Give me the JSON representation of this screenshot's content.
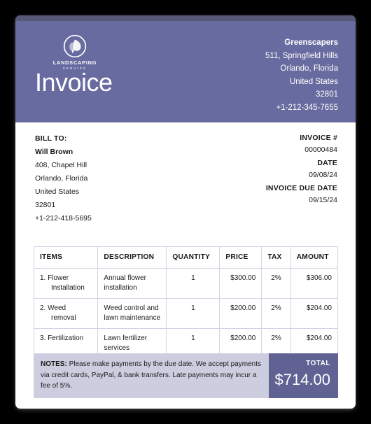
{
  "theme": {
    "header_bg": "#686b9f",
    "header_strip": "#565878",
    "notes_bg": "#cdcde0",
    "total_bg": "#5f6293",
    "page_bg": "#000000",
    "card_bg": "#ffffff",
    "table_border": "#d3d4e2"
  },
  "header": {
    "logo": {
      "icon": "leaf-circle-logo-icon",
      "name": "LANDSCAPING",
      "sub": "SERVICE"
    },
    "title": "Invoice",
    "company": {
      "name": "Greenscapers",
      "address1": "511, Springfield Hills",
      "address2": "Orlando, Florida",
      "country": "United States",
      "zip": "32801",
      "phone": "+1-212-345-7655"
    }
  },
  "bill_to": {
    "label": "BILL TO:",
    "name": "Will Brown",
    "address1": "408, Chapel Hill",
    "address2": "Orlando, Florida",
    "country": "United States",
    "zip": "32801",
    "phone": "+1-212-418-5695"
  },
  "meta": {
    "invoice_number_label": "INVOICE #",
    "invoice_number": "00000484",
    "date_label": "DATE",
    "date": "09/08/24",
    "due_date_label": "INVOICE DUE DATE",
    "due_date": "09/15/24"
  },
  "table": {
    "columns": [
      "ITEMS",
      "DESCRIPTION",
      "QUANTITY",
      "PRICE",
      "TAX",
      "AMOUNT"
    ],
    "rows": [
      {
        "item": "1. Flower Installation",
        "description": "Annual flower installation",
        "quantity": "1",
        "price": "$300.00",
        "tax": "2%",
        "amount": "$306.00"
      },
      {
        "item": "2. Weed removal",
        "description": "Weed control and lawn maintenance",
        "quantity": "1",
        "price": "$200.00",
        "tax": "2%",
        "amount": "$204.00"
      },
      {
        "item": "3. Fertilization",
        "description": "Lawn fertilizer services",
        "quantity": "1",
        "price": "$200.00",
        "tax": "2%",
        "amount": "$204.00"
      }
    ]
  },
  "footer": {
    "notes_label": "NOTES:",
    "notes_text": "Please make payments by the due date. We accept payments via credit cards, PayPal, & bank transfers. Late payments may incur a fee of 5%.",
    "total_label": "TOTAL",
    "total_value": "$714.00"
  }
}
